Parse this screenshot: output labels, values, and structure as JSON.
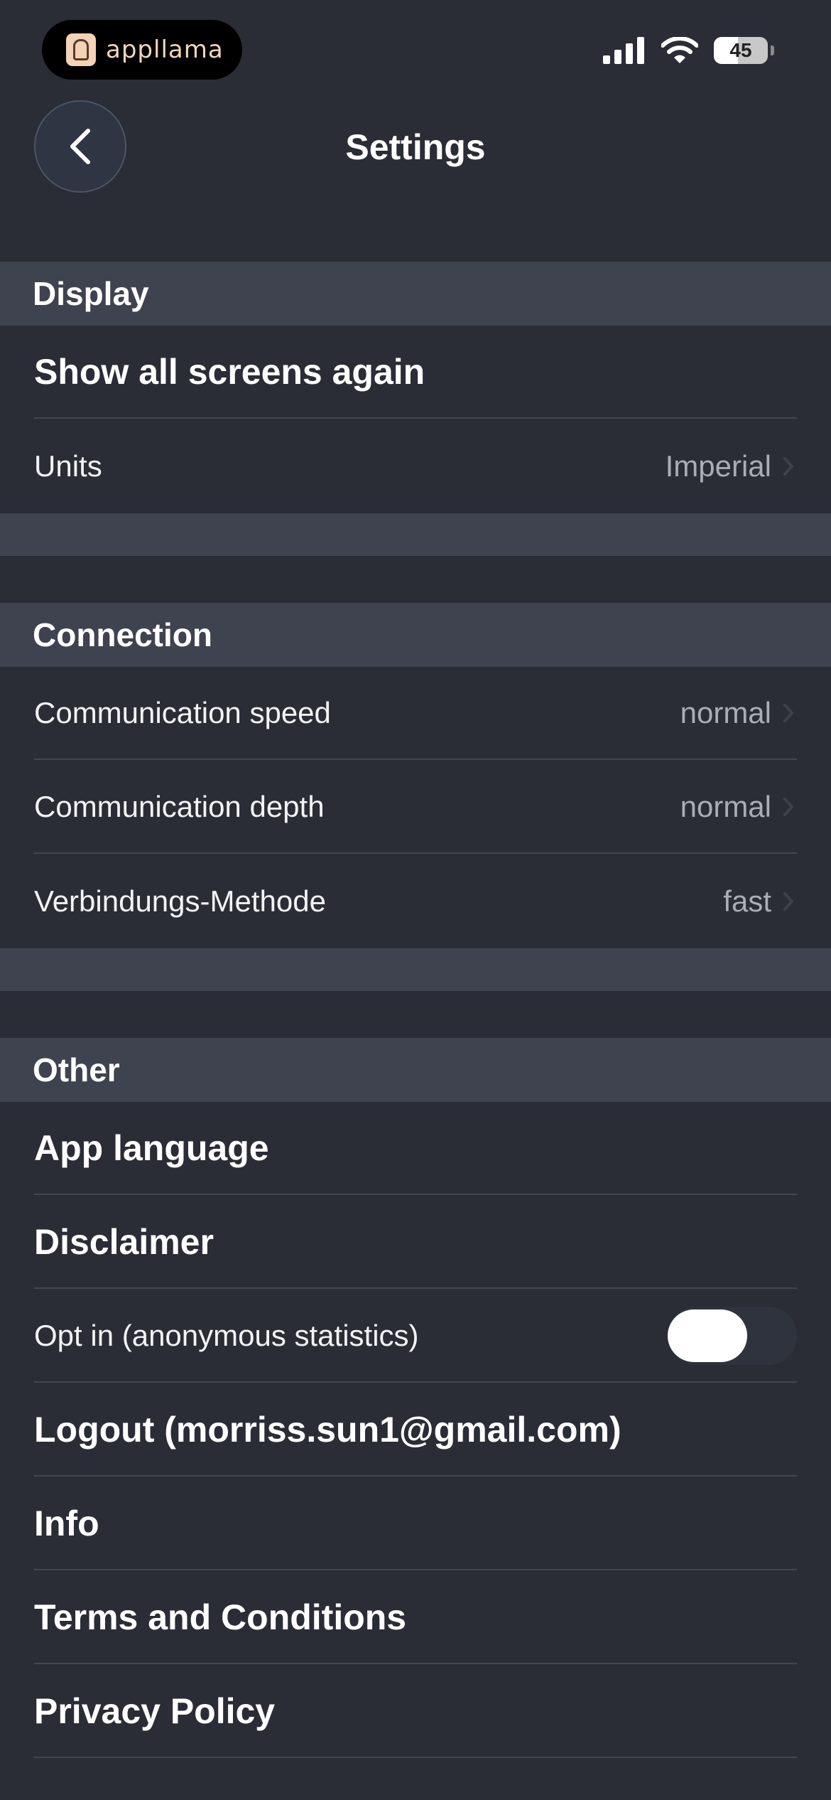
{
  "status_bar": {
    "app_name": "appllama",
    "battery": "45",
    "battery_level": 0.45,
    "icons": [
      "cellular-signal-icon",
      "wifi-icon",
      "battery-icon"
    ]
  },
  "header": {
    "title": "Settings",
    "back_icon": "chevron-left-icon"
  },
  "sections": {
    "display": {
      "title": "Display",
      "show_all_screens": "Show all screens again",
      "units_label": "Units",
      "units_value": "Imperial"
    },
    "connection": {
      "title": "Connection",
      "speed_label": "Communication speed",
      "speed_value": "normal",
      "depth_label": "Communication depth",
      "depth_value": "normal",
      "method_label": "Verbindungs-Methode",
      "method_value": "fast"
    },
    "other": {
      "title": "Other",
      "app_language": "App language",
      "disclaimer": "Disclaimer",
      "opt_in_label": "Opt in (anonymous statistics)",
      "opt_in_enabled": false,
      "logout": "Logout (morriss.sun1@gmail.com)",
      "info": "Info",
      "terms": "Terms and Conditions",
      "privacy": "Privacy Policy"
    }
  },
  "colors": {
    "background": "#2a2d36",
    "section_header": "#3f4350",
    "value_text": "#a9adb6"
  }
}
